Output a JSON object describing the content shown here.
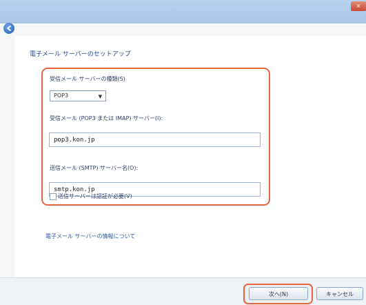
{
  "window": {
    "close_label": "×"
  },
  "heading": "電子メール サーバーのセットアップ",
  "incoming_type": {
    "label": "受信メール サーバーの種類(S)",
    "selected": "POP3"
  },
  "incoming_server": {
    "label": "受信メール (POP3 または IMAP) サーバー(I):",
    "value": "pop3.kon.jp"
  },
  "outgoing_server": {
    "label": "送信メール (SMTP) サーバー名(O):",
    "value": "smtp.kon.jp"
  },
  "auth_checkbox": {
    "label": "送信サーバーは認証が必要(V)",
    "checked": false
  },
  "help_link": "電子メール サーバーの情報について",
  "buttons": {
    "next": "次へ(N)",
    "cancel": "キャンセル"
  },
  "colors": {
    "highlight": "#e6643e",
    "titlebar": "#b9d2ec"
  }
}
